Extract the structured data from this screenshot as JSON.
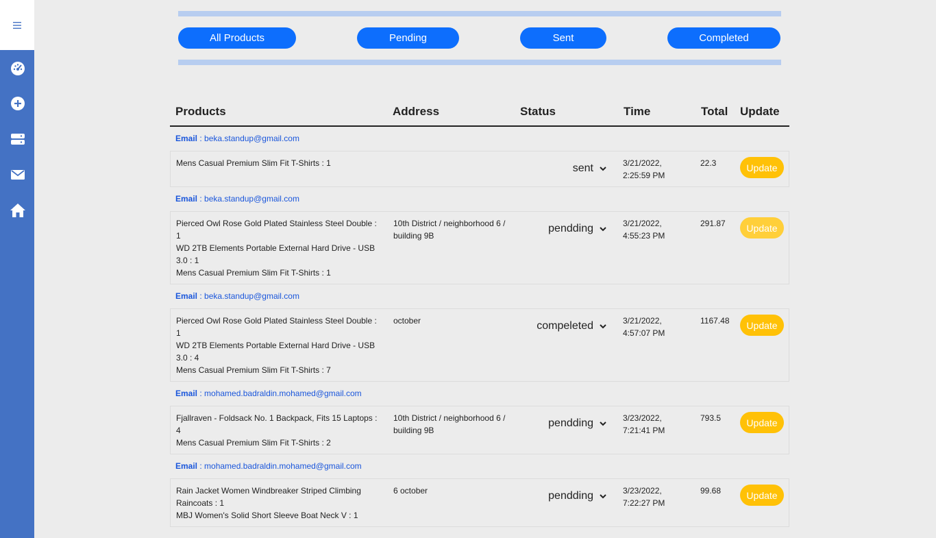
{
  "sidebar": {
    "menu_icon": "hamburger-icon",
    "items": [
      {
        "icon": "dashboard-icon"
      },
      {
        "icon": "add-circle-icon"
      },
      {
        "icon": "server-icon"
      },
      {
        "icon": "mail-icon"
      },
      {
        "icon": "home-icon"
      }
    ]
  },
  "filters": {
    "all": "All Products",
    "pending": "Pending",
    "sent": "Sent",
    "completed": "Completed"
  },
  "table": {
    "headers": {
      "products": "Products",
      "address": "Address",
      "status": "Status",
      "time": "Time",
      "total": "Total",
      "update": "Update"
    },
    "email_label": "Email",
    "email_sep": " : ",
    "orders": [
      {
        "email": "beka.standup@gmail.com",
        "products": [
          "Mens Casual Premium Slim Fit T-Shirts : 1"
        ],
        "address": "",
        "status": "sent",
        "time_date": "3/21/2022,",
        "time_clock": "2:25:59 PM",
        "total": "22.3",
        "update": "Update"
      },
      {
        "email": "beka.standup@gmail.com",
        "products": [
          "Pierced Owl Rose Gold Plated Stainless Steel Double :",
          "1",
          "WD 2TB Elements Portable External Hard Drive - USB",
          "3.0 : 1",
          "Mens Casual Premium Slim Fit T-Shirts : 1"
        ],
        "address": "10th District / neighborhood 6 / building 9B",
        "status": "pendding",
        "time_date": "3/21/2022,",
        "time_clock": "4:55:23 PM",
        "total": "291.87",
        "update": "Update"
      },
      {
        "email": "beka.standup@gmail.com",
        "products": [
          "Pierced Owl Rose Gold Plated Stainless Steel Double :",
          "1",
          "WD 2TB Elements Portable External Hard Drive - USB",
          "3.0 : 4",
          "Mens Casual Premium Slim Fit T-Shirts : 7"
        ],
        "address": "october",
        "status": "compeleted",
        "time_date": "3/21/2022,",
        "time_clock": "4:57:07 PM",
        "total": "1167.48",
        "update": "Update"
      },
      {
        "email": "mohamed.badraldin.mohamed@gmail.com",
        "products": [
          "Fjallraven - Foldsack No. 1 Backpack, Fits 15 Laptops :",
          "4",
          "Mens Casual Premium Slim Fit T-Shirts : 2"
        ],
        "address": "10th District / neighborhood 6 / building 9B",
        "status": "pendding",
        "time_date": "3/23/2022,",
        "time_clock": "7:21:41 PM",
        "total": "793.5",
        "update": "Update"
      },
      {
        "email": "mohamed.badraldin.mohamed@gmail.com",
        "products": [
          "Rain Jacket Women Windbreaker Striped Climbing",
          "Raincoats : 1",
          "MBJ Women's Solid Short Sleeve Boat Neck V : 1"
        ],
        "address": "6 october",
        "status": "pendding",
        "time_date": "3/23/2022,",
        "time_clock": "7:22:27 PM",
        "total": "99.68",
        "update": "Update"
      }
    ]
  }
}
